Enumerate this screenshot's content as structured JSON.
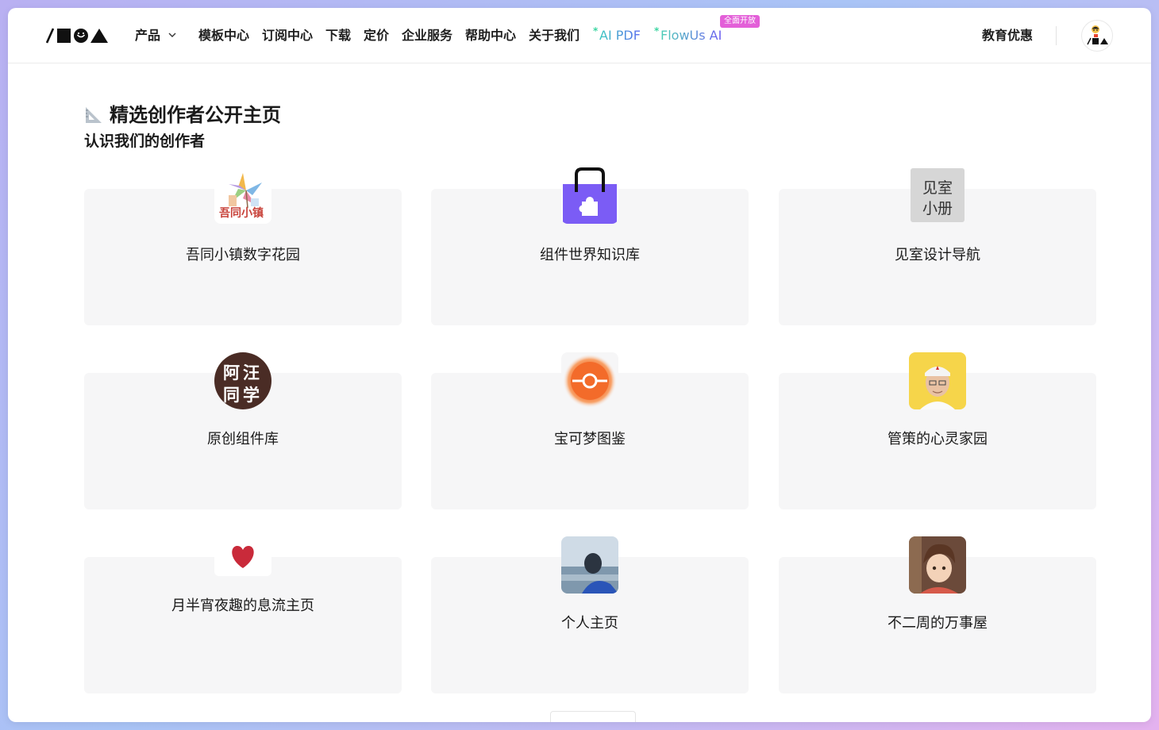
{
  "nav": {
    "items": [
      "产品",
      "模板中心",
      "订阅中心",
      "下载",
      "定价",
      "企业服务",
      "帮助中心",
      "关于我们"
    ],
    "ai_pdf": "AI PDF",
    "flowus_ai": "FlowUs AI",
    "flowus_ai_badge": "全面开放",
    "edu": "教育优惠",
    "ai_spark": "*"
  },
  "section": {
    "title": "精选创作者公开主页",
    "subtitle": "认识我们的创作者"
  },
  "cards": [
    {
      "name": "吾同小镇数字花园",
      "avatar_text": "吾同小镇"
    },
    {
      "name": "组件世界知识库"
    },
    {
      "name": "见室设计导航",
      "avatar_text_1": "见室",
      "avatar_text_2": "小册"
    },
    {
      "name": "原创组件库",
      "avatar_text_1": "阿汪",
      "avatar_text_2": "同学"
    },
    {
      "name": "宝可梦图鉴"
    },
    {
      "name": "管策的心灵家园"
    },
    {
      "name": "月半宵夜趣的息流主页"
    },
    {
      "name": "个人主页"
    },
    {
      "name": "不二周的万事屋"
    }
  ],
  "colors": {
    "card_bg": "#f6f6f7",
    "puzzle_purple": "#7b5cf5",
    "badge_pink": "#e35fd8",
    "pokeball_orange": "#f36b2a"
  }
}
